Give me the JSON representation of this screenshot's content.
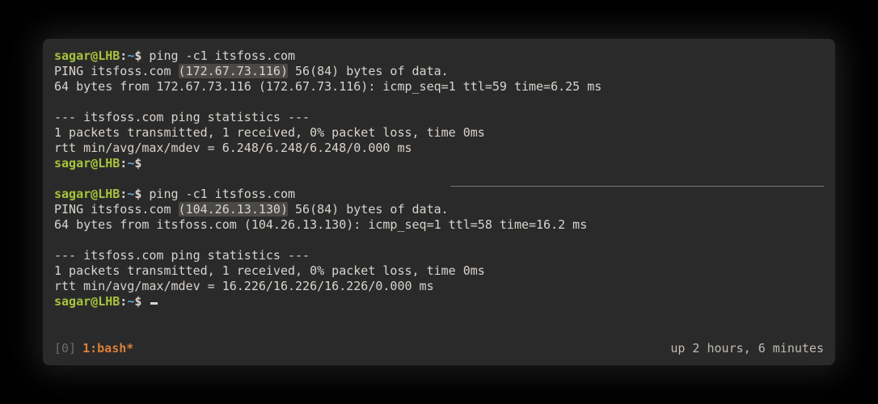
{
  "prompt": {
    "user": "sagar",
    "at": "@",
    "host": "LHB",
    "colon": ":",
    "tilde": "~",
    "dollar": "$"
  },
  "top": {
    "cmd": " ping -c1 itsfoss.com",
    "l1a": "PING itsfoss.com ",
    "l1b": "(172.67.73.116)",
    "l1c": " 56(84) bytes of data.",
    "l2": "64 bytes from 172.67.73.116 (172.67.73.116): icmp_seq=1 ttl=59 time=6.25 ms",
    "l3": "",
    "l4": "--- itsfoss.com ping statistics ---",
    "l5": "1 packets transmitted, 1 received, 0% packet loss, time 0ms",
    "l6": "rtt min/avg/max/mdev = 6.248/6.248/6.248/0.000 ms",
    "trail": " "
  },
  "bottom": {
    "cmd": " ping -c1 itsfoss.com",
    "l1a": "PING itsfoss.com ",
    "l1b": "(104.26.13.130)",
    "l1c": " 56(84) bytes of data.",
    "l2": "64 bytes from itsfoss.com (104.26.13.130): icmp_seq=1 ttl=58 time=16.2 ms",
    "l3": "",
    "l4": "--- itsfoss.com ping statistics ---",
    "l5": "1 packets transmitted, 1 received, 0% packet loss, time 0ms",
    "l6": "rtt min/avg/max/mdev = 16.226/16.226/16.226/0.000 ms",
    "trail": " "
  },
  "status": {
    "idx": "[0]",
    "win": "1:bash*",
    "uptime": "up 2 hours, 6 minutes"
  }
}
